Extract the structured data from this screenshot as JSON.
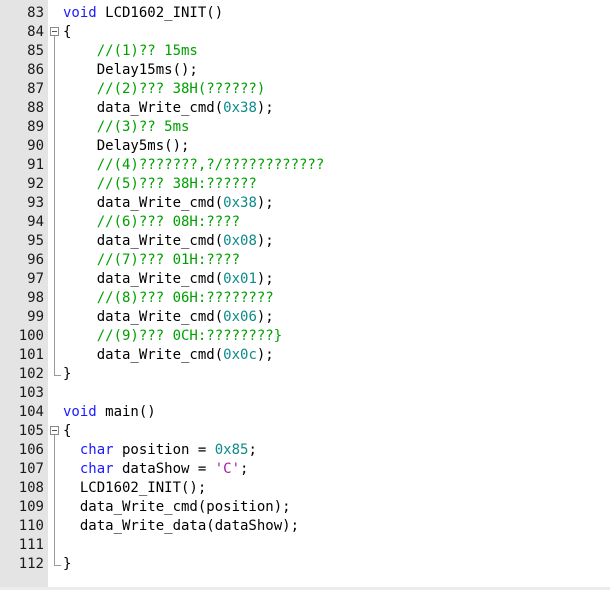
{
  "editor": {
    "lines": [
      {
        "n": "83",
        "fold": "none",
        "parts": [
          {
            "t": "void",
            "c": "kw"
          },
          {
            "t": " LCD1602_INIT()",
            "c": "fn"
          }
        ]
      },
      {
        "n": "84",
        "fold": "open",
        "parts": [
          {
            "t": "{",
            "c": "fn"
          }
        ]
      },
      {
        "n": "85",
        "fold": "line",
        "parts": [
          {
            "t": "    ",
            "c": "fn"
          },
          {
            "t": "//(1)?? 15ms",
            "c": "cm"
          }
        ]
      },
      {
        "n": "86",
        "fold": "line",
        "parts": [
          {
            "t": "    Delay15ms();",
            "c": "fn"
          }
        ]
      },
      {
        "n": "87",
        "fold": "line",
        "parts": [
          {
            "t": "    ",
            "c": "fn"
          },
          {
            "t": "//(2)??? 38H(??????)",
            "c": "cm"
          }
        ]
      },
      {
        "n": "88",
        "fold": "line",
        "parts": [
          {
            "t": "    data_Write_cmd(",
            "c": "fn"
          },
          {
            "t": "0x38",
            "c": "num"
          },
          {
            "t": ");",
            "c": "fn"
          }
        ]
      },
      {
        "n": "89",
        "fold": "line",
        "parts": [
          {
            "t": "    ",
            "c": "fn"
          },
          {
            "t": "//(3)?? 5ms",
            "c": "cm"
          }
        ]
      },
      {
        "n": "90",
        "fold": "line",
        "parts": [
          {
            "t": "    Delay5ms();",
            "c": "fn"
          }
        ]
      },
      {
        "n": "91",
        "fold": "line",
        "parts": [
          {
            "t": "    ",
            "c": "fn"
          },
          {
            "t": "//(4)???????,?/????????????",
            "c": "cm"
          }
        ]
      },
      {
        "n": "92",
        "fold": "line",
        "parts": [
          {
            "t": "    ",
            "c": "fn"
          },
          {
            "t": "//(5)??? 38H:??????",
            "c": "cm"
          }
        ]
      },
      {
        "n": "93",
        "fold": "line",
        "parts": [
          {
            "t": "    data_Write_cmd(",
            "c": "fn"
          },
          {
            "t": "0x38",
            "c": "num"
          },
          {
            "t": ");",
            "c": "fn"
          }
        ]
      },
      {
        "n": "94",
        "fold": "line",
        "parts": [
          {
            "t": "    ",
            "c": "fn"
          },
          {
            "t": "//(6)??? 08H:????",
            "c": "cm"
          }
        ]
      },
      {
        "n": "95",
        "fold": "line",
        "parts": [
          {
            "t": "    data_Write_cmd(",
            "c": "fn"
          },
          {
            "t": "0x08",
            "c": "num"
          },
          {
            "t": ");",
            "c": "fn"
          }
        ]
      },
      {
        "n": "96",
        "fold": "line",
        "parts": [
          {
            "t": "    ",
            "c": "fn"
          },
          {
            "t": "//(7)??? 01H:????",
            "c": "cm"
          }
        ]
      },
      {
        "n": "97",
        "fold": "line",
        "parts": [
          {
            "t": "    data_Write_cmd(",
            "c": "fn"
          },
          {
            "t": "0x01",
            "c": "num"
          },
          {
            "t": ");",
            "c": "fn"
          }
        ]
      },
      {
        "n": "98",
        "fold": "line",
        "parts": [
          {
            "t": "    ",
            "c": "fn"
          },
          {
            "t": "//(8)??? 06H:????????",
            "c": "cm"
          }
        ]
      },
      {
        "n": "99",
        "fold": "line",
        "parts": [
          {
            "t": "    data_Write_cmd(",
            "c": "fn"
          },
          {
            "t": "0x06",
            "c": "num"
          },
          {
            "t": ");",
            "c": "fn"
          }
        ]
      },
      {
        "n": "100",
        "fold": "line",
        "parts": [
          {
            "t": "    ",
            "c": "fn"
          },
          {
            "t": "//(9)??? 0CH:????????}",
            "c": "cm"
          }
        ]
      },
      {
        "n": "101",
        "fold": "line",
        "parts": [
          {
            "t": "    data_Write_cmd(",
            "c": "fn"
          },
          {
            "t": "0x0c",
            "c": "num"
          },
          {
            "t": ");",
            "c": "fn"
          }
        ]
      },
      {
        "n": "102",
        "fold": "end",
        "parts": [
          {
            "t": "}",
            "c": "fn"
          }
        ]
      },
      {
        "n": "103",
        "fold": "none",
        "parts": []
      },
      {
        "n": "104",
        "fold": "none",
        "parts": [
          {
            "t": "void",
            "c": "kw"
          },
          {
            "t": " main()",
            "c": "fn"
          }
        ]
      },
      {
        "n": "105",
        "fold": "open",
        "parts": [
          {
            "t": "{",
            "c": "fn"
          }
        ]
      },
      {
        "n": "106",
        "fold": "line",
        "parts": [
          {
            "t": "  ",
            "c": "fn"
          },
          {
            "t": "char",
            "c": "kw"
          },
          {
            "t": " position = ",
            "c": "fn"
          },
          {
            "t": "0x85",
            "c": "num"
          },
          {
            "t": ";",
            "c": "fn"
          }
        ]
      },
      {
        "n": "107",
        "fold": "line",
        "parts": [
          {
            "t": "  ",
            "c": "fn"
          },
          {
            "t": "char",
            "c": "kw"
          },
          {
            "t": " dataShow = ",
            "c": "fn"
          },
          {
            "t": "'C'",
            "c": "str"
          },
          {
            "t": ";",
            "c": "fn"
          }
        ]
      },
      {
        "n": "108",
        "fold": "line",
        "parts": [
          {
            "t": "  LCD1602_INIT();",
            "c": "fn"
          }
        ]
      },
      {
        "n": "109",
        "fold": "line",
        "parts": [
          {
            "t": "  data_Write_cmd(position);",
            "c": "fn"
          }
        ]
      },
      {
        "n": "110",
        "fold": "line",
        "parts": [
          {
            "t": "  data_Write_data(dataShow);",
            "c": "fn"
          }
        ]
      },
      {
        "n": "111",
        "fold": "line",
        "parts": []
      },
      {
        "n": "112",
        "fold": "end",
        "parts": [
          {
            "t": "}",
            "c": "fn"
          }
        ]
      }
    ]
  }
}
